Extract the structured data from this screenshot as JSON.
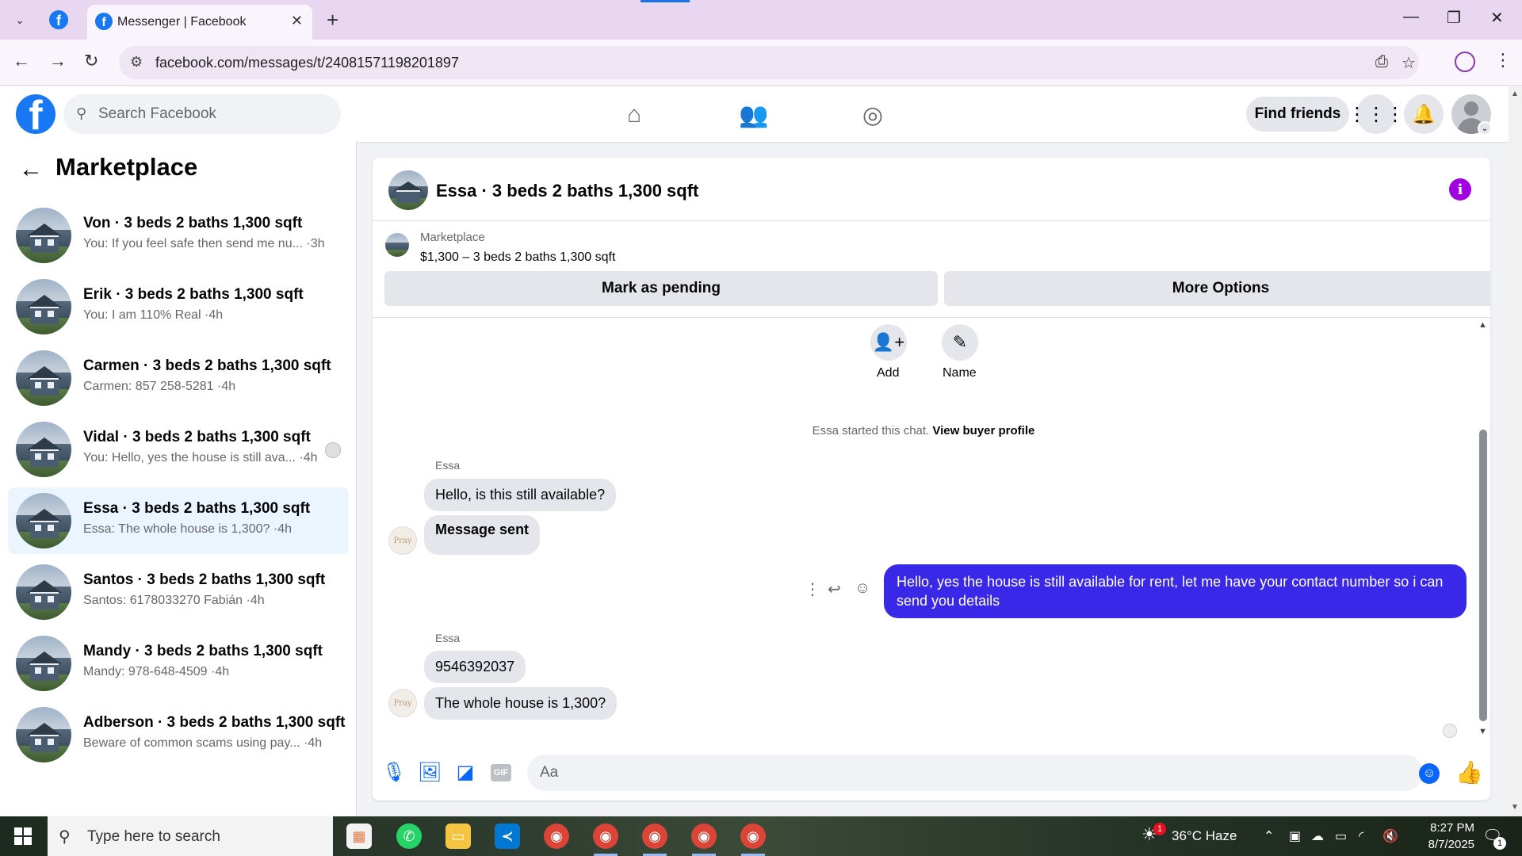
{
  "browser": {
    "tab_title": "Messenger | Facebook",
    "url": "facebook.com/messages/t/24081571198201897",
    "new_tab": "+",
    "close": "✕"
  },
  "fb_header": {
    "logo": "f",
    "search_placeholder": "Search Facebook",
    "find_friends": "Find friends",
    "nav_icons": [
      "home-icon",
      "friends-icon",
      "groups-icon"
    ]
  },
  "sidebar": {
    "title": "Marketplace",
    "conversations": [
      {
        "name": "Von · 3 beds 2 baths 1,300 sqft",
        "preview": "You: If you feel safe then send me nu... ·3h",
        "active": false
      },
      {
        "name": "Erik · 3 beds 2 baths 1,300 sqft",
        "preview": "You: I am 110% Real ·4h",
        "active": false
      },
      {
        "name": "Carmen · 3 beds 2 baths 1,300 sqft",
        "preview": "Carmen: 857 258-5281 ·4h",
        "active": false
      },
      {
        "name": "Vidal · 3 beds 2 baths 1,300 sqft",
        "preview": "You: Hello, yes the house is still ava... ·4h",
        "active": false
      },
      {
        "name": "Essa · 3 beds 2 baths 1,300 sqft",
        "preview": "Essa: The whole house is 1,300? ·4h",
        "active": true
      },
      {
        "name": "Santos · 3 beds 2 baths 1,300 sqft",
        "preview": "Santos: 6178033270 Fabián ·4h",
        "active": false
      },
      {
        "name": "Mandy · 3 beds 2 baths 1,300 sqft",
        "preview": "Mandy: 978-648-4509 ·4h",
        "active": false
      },
      {
        "name": "Adberson · 3 beds 2 baths 1,300 sqft",
        "preview": "Beware of common scams using pay... ·4h",
        "active": false
      }
    ]
  },
  "chat": {
    "title": "Essa · 3 beds 2 baths 1,300 sqft",
    "info_icon": "i",
    "listing": {
      "source": "Marketplace",
      "title": "$1,300 – 3 beds 2 baths 1,300 sqft",
      "mark_pending": "Mark as pending",
      "more_options": "More Options"
    },
    "actions": {
      "add": "Add",
      "name": "Name"
    },
    "system": {
      "text": "Essa started this chat.",
      "link": "View buyer profile"
    },
    "sender": "Essa",
    "messages_in_1": [
      "Hello, is this still available?",
      "Message sent"
    ],
    "message_out": "Hello, yes the house is still available for rent, let me have your contact number so i can send you  details",
    "messages_in_2": [
      "9546392037",
      "The whole house is 1,300?"
    ],
    "composer_placeholder": "Aa",
    "gif": "GIF"
  },
  "taskbar": {
    "search_text": "Type here to search",
    "weather": "36°C Haze",
    "time": "8:27 PM",
    "date": "8/7/2025",
    "notif_count": "1",
    "weather_badge": "1"
  }
}
